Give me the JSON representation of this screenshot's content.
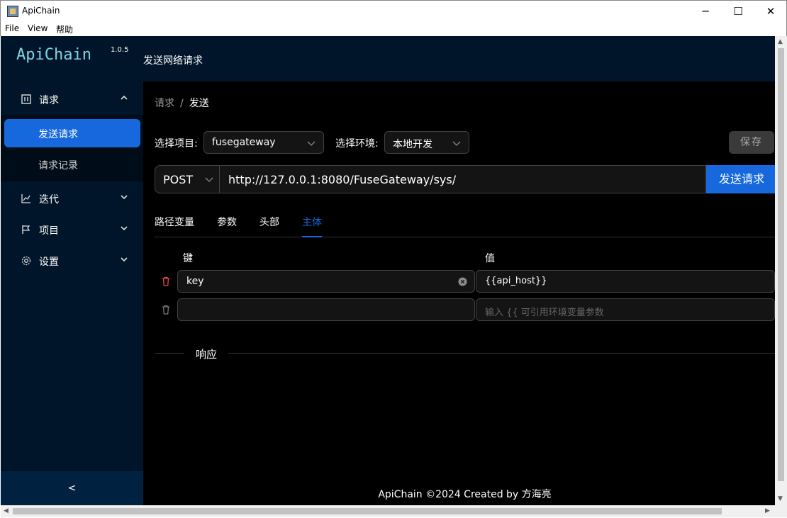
{
  "window": {
    "title": "ApiChain",
    "minimize": "─",
    "maximize": "☐",
    "close": "✕"
  },
  "menubar": {
    "file": "File",
    "view": "View",
    "help": "帮助"
  },
  "sidebar": {
    "logo": "ApiChain",
    "version": "1.0.5",
    "groups": [
      {
        "label": "请求",
        "icon": "panel-icon",
        "expanded": true
      },
      {
        "label": "迭代",
        "icon": "line-chart-icon",
        "expanded": false
      },
      {
        "label": "项目",
        "icon": "flag-icon",
        "expanded": false
      },
      {
        "label": "设置",
        "icon": "gear-icon",
        "expanded": false
      }
    ],
    "sub_items": [
      {
        "label": "发送请求",
        "active": true
      },
      {
        "label": "请求记录",
        "active": false
      }
    ],
    "collapse": "<"
  },
  "header": {
    "title": "发送网络请求"
  },
  "breadcrumb": {
    "parent": "请求",
    "sep": "/",
    "current": "发送"
  },
  "form": {
    "project_label": "选择项目:",
    "project_value": "fusegateway",
    "env_label": "选择环境:",
    "env_value": "本地开发",
    "save_label": "保存"
  },
  "request": {
    "method": "POST",
    "url": "http://127.0.0.1:8080/FuseGateway/sys/",
    "send_label": "发送请求"
  },
  "tabs": [
    {
      "label": "路径变量",
      "active": false
    },
    {
      "label": "参数",
      "active": false
    },
    {
      "label": "头部",
      "active": false
    },
    {
      "label": "主体",
      "active": true
    }
  ],
  "body_table": {
    "key_header": "键",
    "value_header": "值",
    "rows": [
      {
        "key": "key",
        "value": "{{api_host}}"
      },
      {
        "key": "",
        "value_placeholder": "输入 {{ 可引用环境变量参数"
      }
    ]
  },
  "response": {
    "label": "响应"
  },
  "footer": {
    "text": "ApiChain ©2024 Created by 方海亮"
  },
  "colors": {
    "sidebar_bg": "#001529",
    "primary": "#1668dc",
    "content_bg": "#000000",
    "danger": "#e84749"
  }
}
